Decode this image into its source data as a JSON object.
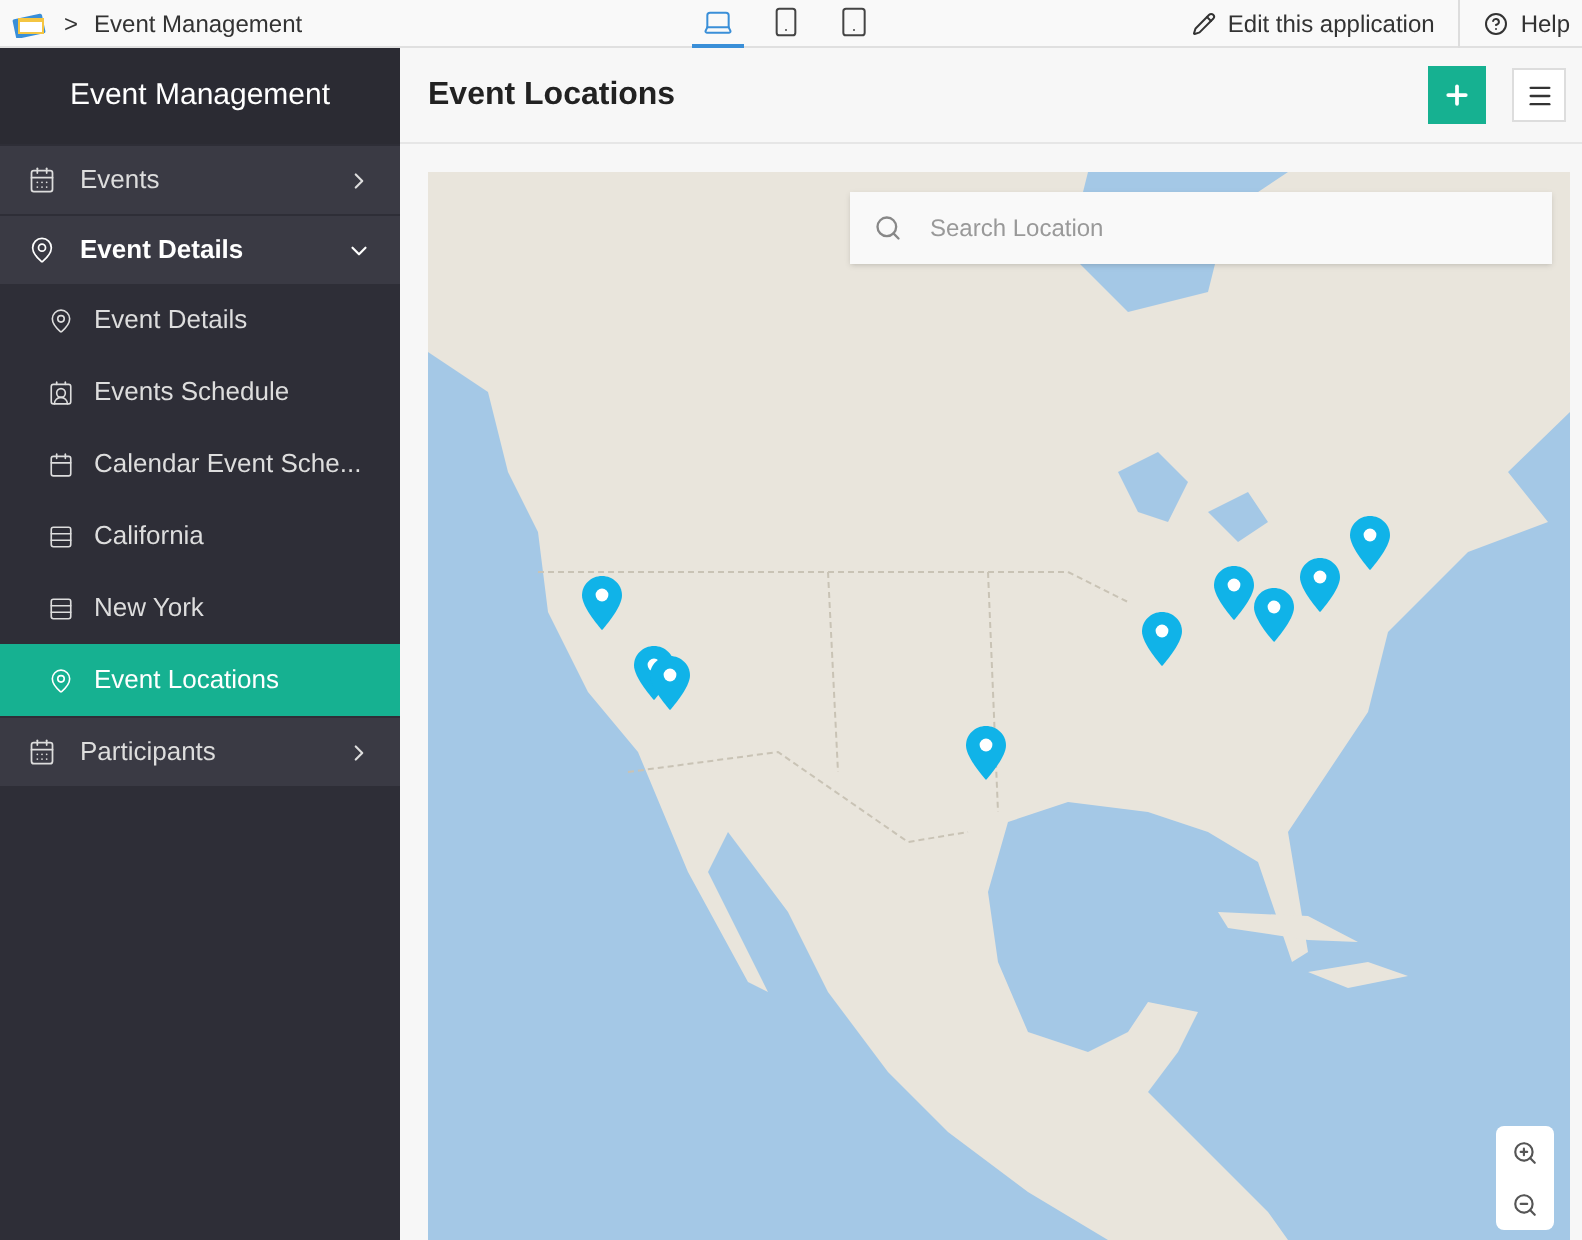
{
  "topbar": {
    "breadcrumb_separator": ">",
    "app_name": "Event Management",
    "devices": [
      {
        "kind": "desktop",
        "selected": true
      },
      {
        "kind": "phone",
        "selected": false
      },
      {
        "kind": "tablet",
        "selected": false
      }
    ],
    "edit_link": "Edit this application",
    "help_link": "Help"
  },
  "sidebar": {
    "title": "Event Management",
    "items": [
      {
        "label": "Events",
        "kind": "calendar",
        "expanded": false
      },
      {
        "label": "Event Details",
        "kind": "pin",
        "expanded": true,
        "children": [
          {
            "label": "Event Details",
            "kind": "pin",
            "selected": false
          },
          {
            "label": "Events Schedule",
            "kind": "people-list",
            "selected": false
          },
          {
            "label": "Calendar Event Sche...",
            "kind": "calendar",
            "selected": false
          },
          {
            "label": "California",
            "kind": "list",
            "selected": false
          },
          {
            "label": "New York",
            "kind": "list",
            "selected": false
          },
          {
            "label": "Event Locations",
            "kind": "pin",
            "selected": true
          }
        ]
      },
      {
        "label": "Participants",
        "kind": "calendar",
        "expanded": false
      }
    ]
  },
  "page": {
    "title": "Event Locations",
    "search": {
      "placeholder": "Search Location"
    }
  }
}
